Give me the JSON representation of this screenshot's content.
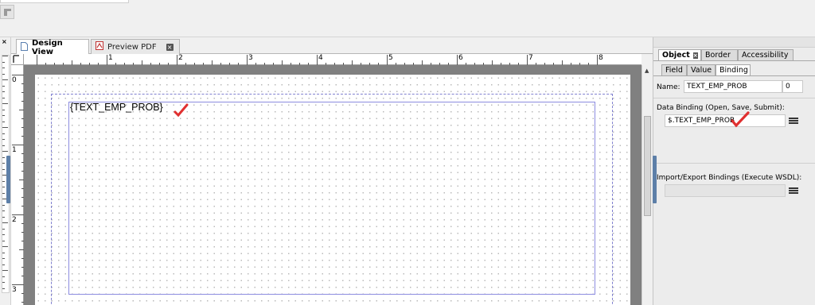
{
  "tabs": [
    {
      "label": "Design View",
      "active": true,
      "icon": "document-icon"
    },
    {
      "label": "Preview PDF",
      "active": false,
      "icon": "pdf-icon"
    }
  ],
  "ruler": {
    "horizontal_labels": [
      "1",
      "2",
      "3",
      "4",
      "5",
      "6",
      "7",
      "8"
    ],
    "vertical_labels": [
      "0",
      "1",
      "2",
      "3"
    ]
  },
  "canvas": {
    "field_text": "{TEXT_EMP_PROB}"
  },
  "object_panel": {
    "tabs": [
      {
        "label": "Object",
        "active": true
      },
      {
        "label": "Border",
        "active": false
      },
      {
        "label": "Accessibility",
        "active": false
      }
    ],
    "subtabs": [
      {
        "label": "Field",
        "active": false
      },
      {
        "label": "Value",
        "active": false
      },
      {
        "label": "Binding",
        "active": true
      }
    ],
    "name_label": "Name:",
    "name_value": "TEXT_EMP_PROB",
    "name_index": "0",
    "data_binding_label": "Data Binding (Open, Save, Submit):",
    "data_binding_value": "$.TEXT_EMP_PROB",
    "import_export_label": "Import/Export Bindings (Execute WSDL):",
    "import_export_value": ""
  },
  "colors": {
    "annotation_check": "#e03030",
    "guide": "#8c8ce0",
    "canvas_bg": "#808080"
  }
}
